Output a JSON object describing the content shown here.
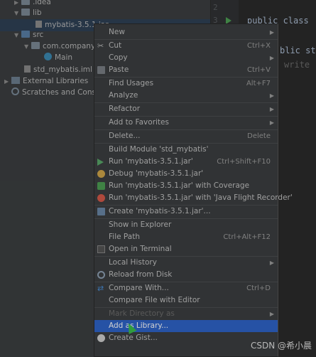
{
  "tree": {
    "items": [
      {
        "label": ".idea"
      },
      {
        "label": "lib"
      },
      {
        "label": "mybatis-3.5.1.jar"
      },
      {
        "label": "src"
      },
      {
        "label": "com.company"
      },
      {
        "label": "Main"
      },
      {
        "label": "std_mybatis.iml"
      },
      {
        "label": "External Libraries"
      },
      {
        "label": "Scratches and Consol"
      }
    ]
  },
  "editor": {
    "line_numbers": [
      "2",
      "3"
    ],
    "code_line1": "public class",
    "code_line2": "blic st",
    "code_line3": "write"
  },
  "menu": {
    "new": "New",
    "cut": "Cut",
    "cut_sc": "Ctrl+X",
    "copy": "Copy",
    "paste": "Paste",
    "paste_sc": "Ctrl+V",
    "find_usages": "Find Usages",
    "find_usages_sc": "Alt+F7",
    "analyze": "Analyze",
    "refactor": "Refactor",
    "add_favorites": "Add to Favorites",
    "delete": "Delete...",
    "delete_sc": "Delete",
    "build_module": "Build Module 'std_mybatis'",
    "run": "Run 'mybatis-3.5.1.jar'",
    "run_sc": "Ctrl+Shift+F10",
    "debug": "Debug 'mybatis-3.5.1.jar'",
    "run_coverage": "Run 'mybatis-3.5.1.jar' with Coverage",
    "run_jfr": "Run 'mybatis-3.5.1.jar' with 'Java Flight Recorder'",
    "create": "Create 'mybatis-3.5.1.jar'...",
    "show_explorer": "Show in Explorer",
    "file_path": "File Path",
    "file_path_sc": "Ctrl+Alt+F12",
    "open_terminal": "Open in Terminal",
    "local_history": "Local History",
    "reload": "Reload from Disk",
    "compare_with": "Compare With...",
    "compare_with_sc": "Ctrl+D",
    "compare_editor": "Compare File with Editor",
    "mark_directory": "Mark Directory as",
    "add_library": "Add as Library...",
    "create_gist": "Create Gist..."
  },
  "watermark": "CSDN @希小晨"
}
